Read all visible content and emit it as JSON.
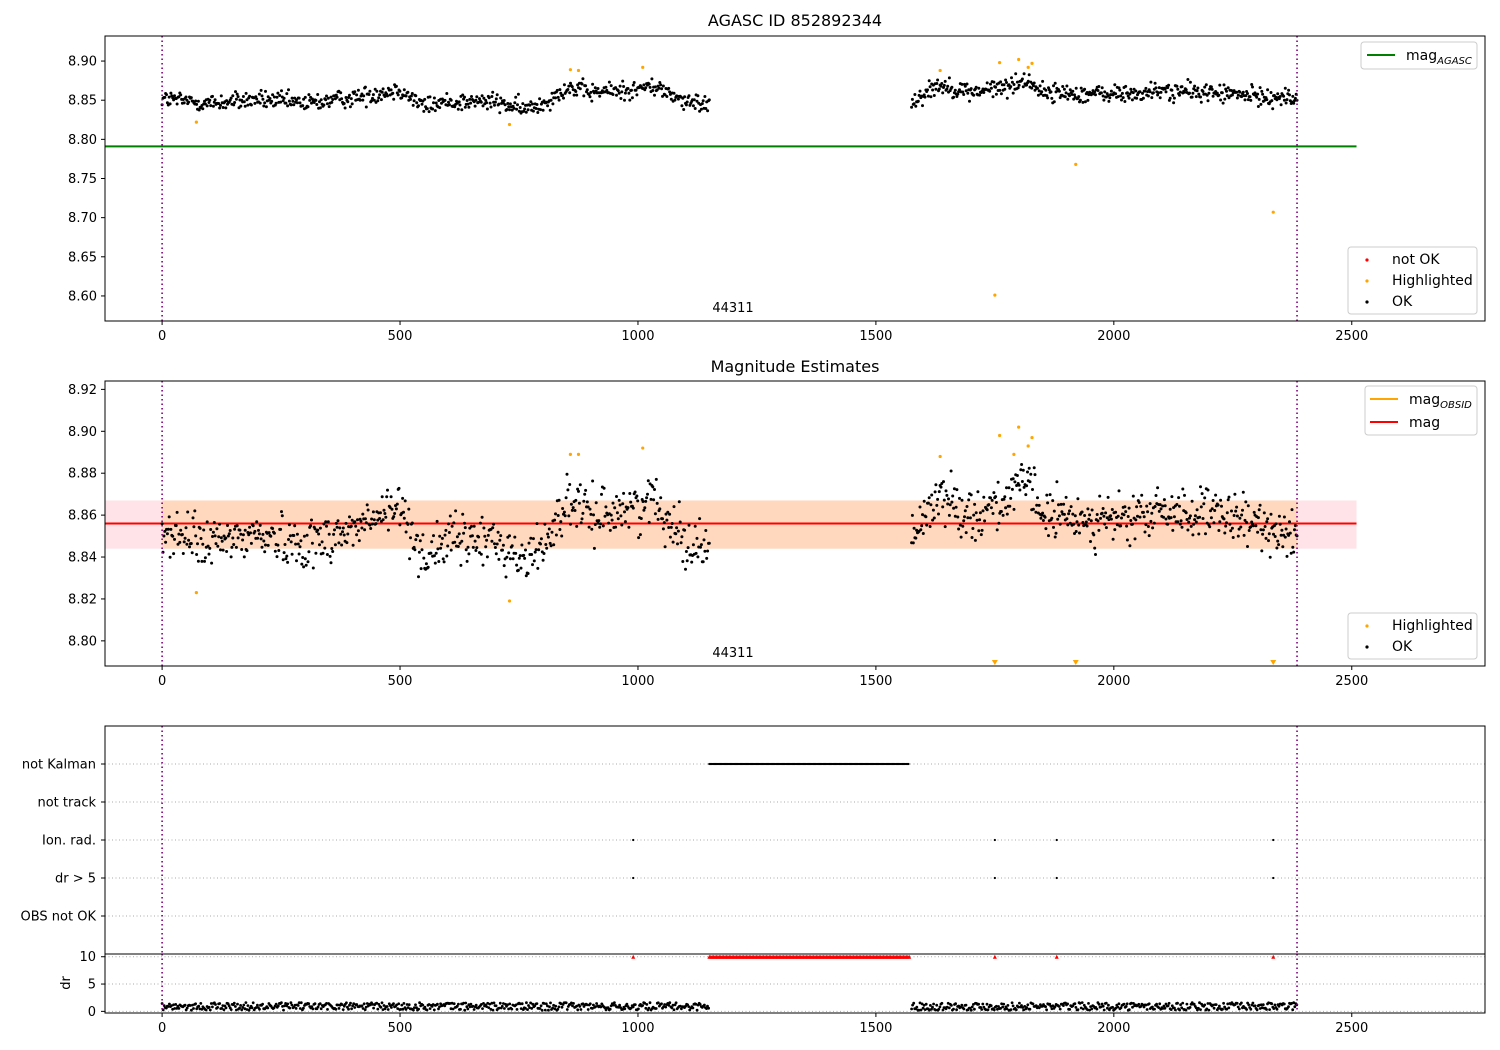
{
  "chart_data": [
    {
      "type": "scatter",
      "title": "AGASC ID 852892344",
      "xlim": [
        -120,
        2780
      ],
      "ylim": [
        8.568,
        8.932
      ],
      "xticks": [
        "0",
        "500",
        "1000",
        "1500",
        "2000",
        "2500"
      ],
      "yticks": [
        "8.60",
        "8.65",
        "8.70",
        "8.75",
        "8.80",
        "8.85",
        "8.90"
      ],
      "ytick_values": [
        8.6,
        8.65,
        8.7,
        8.75,
        8.8,
        8.85,
        8.9
      ],
      "annotation": "44311",
      "vlines": [
        0,
        2385
      ],
      "lines": [
        {
          "name": "mag_AGASC",
          "y": 8.791,
          "x": [
            -120,
            2510
          ],
          "color": "#008000"
        }
      ],
      "series": [
        {
          "name": "not OK",
          "color": "#ff0000",
          "points": []
        },
        {
          "name": "Highlighted",
          "color": "#ffa500",
          "points": [
            [
              72,
              8.822
            ],
            [
              730,
              8.819
            ],
            [
              858,
              8.889
            ],
            [
              875,
              8.888
            ],
            [
              1010,
              8.892
            ],
            [
              1635,
              8.888
            ],
            [
              1750,
              8.601
            ],
            [
              1760,
              8.898
            ],
            [
              1800,
              8.902
            ],
            [
              1820,
              8.892
            ],
            [
              1828,
              8.897
            ],
            [
              1920,
              8.768
            ],
            [
              2335,
              8.707
            ]
          ]
        },
        {
          "name": "OK",
          "color": "#000000",
          "segments": [
            {
              "x0": 0,
              "x1": 1150,
              "anchors": [
                [
                  0,
                  8.852
                ],
                [
                  100,
                  8.846
                ],
                [
                  200,
                  8.851
                ],
                [
                  300,
                  8.846
                ],
                [
                  400,
                  8.853
                ],
                [
                  500,
                  8.864
                ],
                [
                  550,
                  8.842
                ],
                [
                  600,
                  8.848
                ],
                [
                  700,
                  8.848
                ],
                [
                  760,
                  8.838
                ],
                [
                  800,
                  8.846
                ],
                [
                  850,
                  8.866
                ],
                [
                  900,
                  8.86
                ],
                [
                  1000,
                  8.864
                ],
                [
                  1030,
                  8.868
                ],
                [
                  1080,
                  8.855
                ],
                [
                  1100,
                  8.846
                ],
                [
                  1150,
                  8.846
                ]
              ],
              "n": 620,
              "spread": 0.0095
            },
            {
              "x0": 1575,
              "x1": 2385,
              "anchors": [
                [
                  1575,
                  8.848
                ],
                [
                  1630,
                  8.87
                ],
                [
                  1700,
                  8.86
                ],
                [
                  1780,
                  8.868
                ],
                [
                  1820,
                  8.876
                ],
                [
                  1850,
                  8.86
                ],
                [
                  1950,
                  8.858
                ],
                [
                  2050,
                  8.858
                ],
                [
                  2100,
                  8.862
                ],
                [
                  2200,
                  8.86
                ],
                [
                  2300,
                  8.855
                ],
                [
                  2385,
                  8.852
                ]
              ],
              "n": 460,
              "spread": 0.0095
            }
          ]
        }
      ],
      "legends": [
        [
          "mag_AGASC"
        ],
        [
          "not OK",
          "Highlighted",
          "OK"
        ]
      ]
    },
    {
      "type": "scatter",
      "title": "Magnitude Estimates",
      "xlim": [
        -120,
        2780
      ],
      "ylim": [
        8.788,
        8.924
      ],
      "xticks": [
        "0",
        "500",
        "1000",
        "1500",
        "2000",
        "2500"
      ],
      "yticks": [
        "8.80",
        "8.82",
        "8.84",
        "8.86",
        "8.88",
        "8.90",
        "8.92"
      ],
      "ytick_values": [
        8.8,
        8.82,
        8.84,
        8.86,
        8.88,
        8.9,
        8.92
      ],
      "annotation": "44311",
      "vlines": [
        0,
        2385
      ],
      "band": {
        "y0": 8.844,
        "y1": 8.867
      },
      "lines": [
        {
          "name": "mag",
          "y": 8.856,
          "x": [
            -120,
            2510
          ],
          "color": "#ff0000"
        }
      ],
      "series": [
        {
          "name": "Highlighted",
          "color": "#ffa500",
          "points": [
            [
              72,
              8.823
            ],
            [
              730,
              8.819
            ],
            [
              858,
              8.889
            ],
            [
              875,
              8.889
            ],
            [
              1010,
              8.892
            ],
            [
              1635,
              8.888
            ],
            [
              1760,
              8.898
            ],
            [
              1790,
              8.889
            ],
            [
              1800,
              8.902
            ],
            [
              1820,
              8.893
            ],
            [
              1828,
              8.897
            ]
          ],
          "offscale_low": [
            1750,
            1920,
            2335
          ]
        },
        {
          "name": "OK",
          "color": "#000000",
          "segments": [
            {
              "x0": 0,
              "x1": 1150,
              "anchors": [
                [
                  0,
                  8.852
                ],
                [
                  100,
                  8.846
                ],
                [
                  200,
                  8.851
                ],
                [
                  300,
                  8.846
                ],
                [
                  400,
                  8.853
                ],
                [
                  500,
                  8.864
                ],
                [
                  550,
                  8.84
                ],
                [
                  600,
                  8.848
                ],
                [
                  700,
                  8.848
                ],
                [
                  760,
                  8.838
                ],
                [
                  800,
                  8.846
                ],
                [
                  850,
                  8.866
                ],
                [
                  900,
                  8.86
                ],
                [
                  1000,
                  8.864
                ],
                [
                  1030,
                  8.868
                ],
                [
                  1080,
                  8.855
                ],
                [
                  1100,
                  8.846
                ],
                [
                  1150,
                  8.846
                ]
              ],
              "n": 620,
              "spread": 0.0095
            },
            {
              "x0": 1575,
              "x1": 2385,
              "anchors": [
                [
                  1575,
                  8.848
                ],
                [
                  1630,
                  8.87
                ],
                [
                  1700,
                  8.86
                ],
                [
                  1780,
                  8.868
                ],
                [
                  1820,
                  8.876
                ],
                [
                  1850,
                  8.86
                ],
                [
                  1950,
                  8.858
                ],
                [
                  2050,
                  8.858
                ],
                [
                  2100,
                  8.862
                ],
                [
                  2200,
                  8.86
                ],
                [
                  2300,
                  8.855
                ],
                [
                  2385,
                  8.852
                ]
              ],
              "n": 460,
              "spread": 0.0095
            }
          ]
        }
      ],
      "legends": [
        [
          "mag_OBSID",
          "mag"
        ],
        [
          "Highlighted",
          "OK"
        ]
      ]
    },
    {
      "type": "scatter",
      "title": "",
      "xlim": [
        -120,
        2780
      ],
      "categories": [
        "not Kalman",
        "not track",
        "Ion. rad.",
        "dr > 5",
        "OBS not OK"
      ],
      "flags": {
        "not Kalman": {
          "ranges": [
            [
              1150,
              1570
            ]
          ],
          "points": []
        },
        "not track": {
          "ranges": [],
          "points": []
        },
        "Ion. rad.": {
          "ranges": [],
          "points": [
            990,
            1750,
            1880,
            2335
          ]
        },
        "dr > 5": {
          "ranges": [],
          "points": [
            990,
            1750,
            1880,
            2335
          ]
        },
        "OBS not OK": {
          "ranges": [],
          "points": []
        }
      },
      "vlines": [
        0,
        2385
      ]
    },
    {
      "type": "scatter",
      "title": "",
      "ylabel": "dr",
      "xlim": [
        -120,
        2780
      ],
      "ylim": [
        -0.3,
        10.5
      ],
      "xticks": [
        "0",
        "500",
        "1000",
        "1500",
        "2000",
        "2500"
      ],
      "yticks": [
        "0",
        "5",
        "10"
      ],
      "ytick_values": [
        0,
        5,
        10
      ],
      "vlines": [
        0,
        2385
      ],
      "clipped_at_10": {
        "ranges": [
          [
            1150,
            1570
          ]
        ],
        "points": [
          990,
          1750,
          1880,
          2335
        ],
        "color": "#ff0000"
      },
      "dr_segments": [
        [
          0,
          1150
        ],
        [
          1575,
          2385
        ]
      ],
      "dr_typical": [
        0.2,
        1.6
      ]
    }
  ],
  "colors": {
    "green": "#008000",
    "red": "#ff0000",
    "orange": "#ffa500",
    "purple": "#800080",
    "band": "#ffc0cb"
  }
}
